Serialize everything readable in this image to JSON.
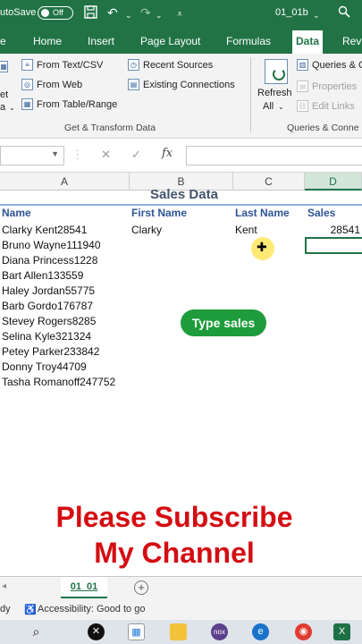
{
  "titlebar": {
    "autosave_label": "utoSave",
    "autosave_state": "Off",
    "filename": "01_01b"
  },
  "ribbon_tabs": [
    "e",
    "Home",
    "Insert",
    "Page Layout",
    "Formulas",
    "Data",
    "Revi"
  ],
  "active_tab": "Data",
  "ribbon": {
    "get_transform": {
      "left_fragment_1": "et",
      "left_fragment_2": "a",
      "from_text_csv": "From Text/CSV",
      "from_web": "From Web",
      "from_table_range": "From Table/Range",
      "recent_sources": "Recent Sources",
      "existing_connections": "Existing Connections",
      "group_label": "Get & Transform Data"
    },
    "queries": {
      "refresh_all_line1": "Refresh",
      "refresh_all_line2": "All",
      "queries_connections": "Queries & C",
      "properties": "Properties",
      "edit_links": "Edit Links",
      "group_label": "Queries & Conne"
    }
  },
  "formula_bar": {
    "cancel": "✕",
    "enter": "✓",
    "fx": "fx"
  },
  "columns": [
    "A",
    "B",
    "C",
    "D"
  ],
  "selected_column": "D",
  "sheet": {
    "title": "Sales Data",
    "headers": [
      "Name",
      "First Name",
      "Last Name",
      "Sales"
    ],
    "rows": [
      {
        "name": "Clarky Kent28541",
        "first": "Clarky",
        "last": "Kent",
        "sales": "28541"
      },
      {
        "name": "Bruno Wayne111940"
      },
      {
        "name": "Diana Princess1228"
      },
      {
        "name": "Bart Allen133559"
      },
      {
        "name": "Haley Jordan55775"
      },
      {
        "name": "Barb Gordo176787"
      },
      {
        "name": "Stevey Rogers8285"
      },
      {
        "name": "Selina Kyle321324"
      },
      {
        "name": "Petey Parker233842"
      },
      {
        "name": "Donny Troy44709"
      },
      {
        "name": "Tasha Romanoff247752"
      }
    ]
  },
  "overlay": {
    "badge": "Type sales",
    "subscribe_line1": "Please Subscribe",
    "subscribe_line2": "My Channel"
  },
  "sheet_tabs": {
    "active": "01_01",
    "add": "+"
  },
  "statusbar": {
    "ready_fragment": "dy",
    "accessibility": "Accessibility: Good to go"
  },
  "taskbar": {
    "excel_label": "X"
  }
}
